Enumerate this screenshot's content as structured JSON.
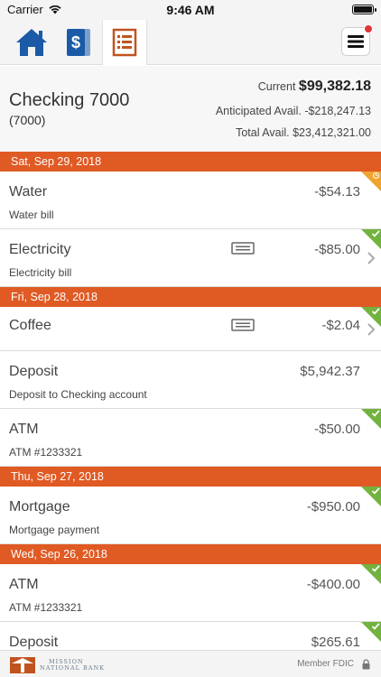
{
  "status": {
    "carrier": "Carrier",
    "time": "9:46 AM"
  },
  "nav": {
    "tabs": [
      {
        "name": "home",
        "icon": "house-icon"
      },
      {
        "name": "money",
        "icon": "dollar-card-icon"
      },
      {
        "name": "statement",
        "icon": "document-list-icon",
        "active": true
      }
    ],
    "menu_icon": "hamburger-icon"
  },
  "account": {
    "name": "Checking 7000",
    "number": "(7000)",
    "current_label": "Current",
    "current_value": "$99,382.18",
    "anticipated_label": "Anticipated Avail.",
    "anticipated_value": "-$218,247.13",
    "total_label": "Total Avail.",
    "total_value": "$23,412,321.00"
  },
  "groups": [
    {
      "date": "Sat, Sep 29, 2018",
      "items": [
        {
          "desc": "Water",
          "memo": "Water bill",
          "amount": "-$54.13",
          "status": "pending"
        },
        {
          "desc": "Electricity",
          "memo": "Electricity bill",
          "amount": "-$85.00",
          "status": "cleared",
          "has_note": true,
          "has_chevron": true
        }
      ]
    },
    {
      "date": "Fri, Sep 28, 2018",
      "items": [
        {
          "desc": "Coffee",
          "memo": "",
          "amount": "-$2.04",
          "status": "cleared",
          "has_note": true,
          "has_chevron": true
        },
        {
          "desc": "Deposit",
          "memo": "Deposit to Checking account",
          "amount": "$5,942.37",
          "status": "none"
        },
        {
          "desc": "ATM",
          "memo": "ATM #1233321",
          "amount": "-$50.00",
          "status": "cleared"
        }
      ]
    },
    {
      "date": "Thu, Sep 27, 2018",
      "items": [
        {
          "desc": "Mortgage",
          "memo": "Mortgage payment",
          "amount": "-$950.00",
          "status": "cleared"
        }
      ]
    },
    {
      "date": "Wed, Sep 26, 2018",
      "items": [
        {
          "desc": "ATM",
          "memo": "ATM #1233321",
          "amount": "-$400.00",
          "status": "cleared"
        },
        {
          "desc": "Deposit",
          "memo": "",
          "amount": "$265.61",
          "status": "cleared"
        }
      ]
    }
  ],
  "footer": {
    "bank_line1": "MISSION",
    "bank_line2": "NATIONAL BANK",
    "fdic": "Member FDIC"
  },
  "colors": {
    "accent": "#e05a24",
    "cleared": "#72b23e",
    "pending": "#f0a430",
    "brand_blue": "#1a5aa6"
  }
}
